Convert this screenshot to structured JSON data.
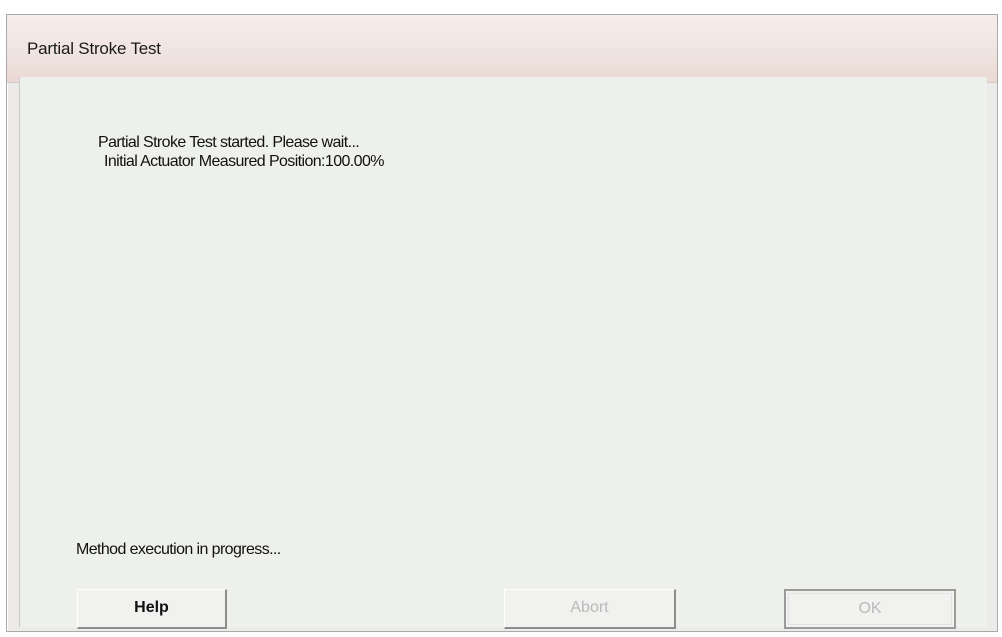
{
  "window": {
    "title": "Partial Stroke Test"
  },
  "message": {
    "line1": "Partial Stroke Test started.  Please wait...",
    "line2": "Initial Actuator Measured Position:100.00%"
  },
  "status": {
    "text": "Method execution in progress..."
  },
  "buttons": {
    "help_label": "Help",
    "abort_label": "Abort",
    "ok_label": "OK",
    "abort_enabled": false,
    "ok_enabled": false
  },
  "colors": {
    "dialog_background": "#eef0ec",
    "titlebar_background": "#efe3df",
    "disabled_text": "#b9b9b9"
  }
}
